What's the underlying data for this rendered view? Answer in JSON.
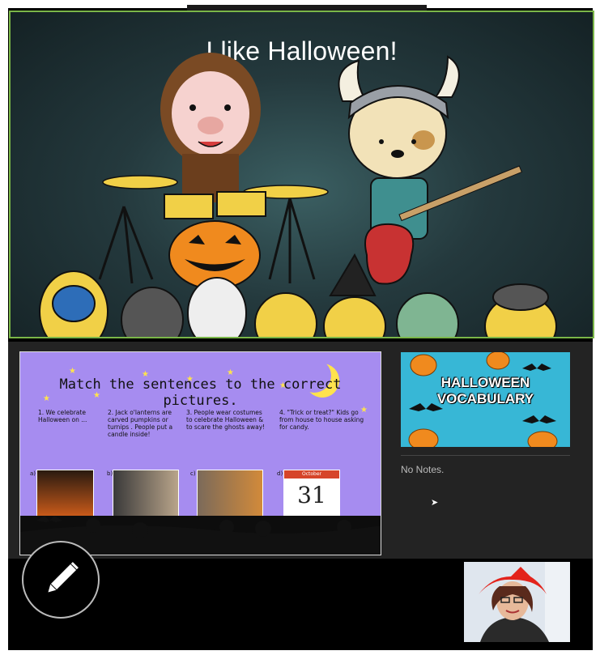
{
  "video": {
    "title": "I like Halloween!"
  },
  "slide": {
    "title": "Match the sentences to the correct pictures.",
    "sentences": [
      "1. We celebrate Halloween on ...",
      "2. Jack o'lanterns are carved pumpkins or turnips . People put a candle inside!",
      "3. People wear costumes to celebrate Halloween & to scare the ghosts away!",
      "4. \"Trick or treat?\" Kids go from house to house asking for candy."
    ],
    "picture_labels": [
      "a)",
      "b)",
      "c)",
      "d)"
    ],
    "calendar_month": "October",
    "calendar_day": "31"
  },
  "thumbnail": {
    "title_line1": "HALLOWEEN",
    "title_line2": "VOCABULARY"
  },
  "notes": {
    "text": "No Notes."
  },
  "icons": {
    "pen": "pencil-icon",
    "cursor": "arrow-cursor-icon"
  },
  "colors": {
    "video_border": "#7ab648",
    "slide_bg": "#a68cf0",
    "thumbnail_bg": "#37b7d6"
  }
}
